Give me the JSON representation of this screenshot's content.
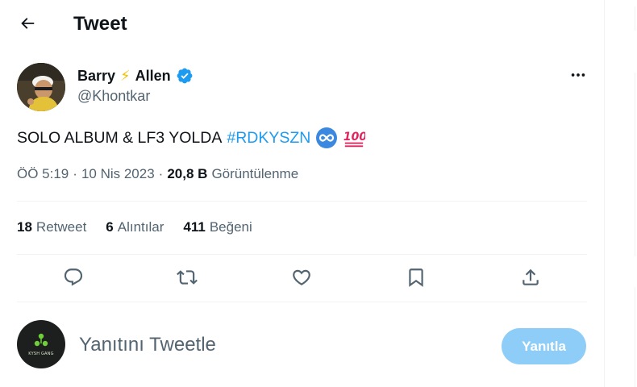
{
  "header": {
    "title": "Tweet",
    "back_icon": "arrow-left-icon"
  },
  "author": {
    "display_name_first": "Barry",
    "display_name_emoji": "⚡",
    "display_name_last": "Allen",
    "handle": "@Khontkar",
    "verified_icon": "verified-badge-icon",
    "verified_color": "#1d9bf0"
  },
  "tweet": {
    "text": "SOLO ALBUM & LF3 YOLDA",
    "hashtag": "#RDKYSZN",
    "emojis": [
      "infinity-emoji",
      "hundred-points-emoji"
    ]
  },
  "meta": {
    "time": "ÖÖ 5:19",
    "separator": "·",
    "date": "10 Nis 2023",
    "views_count": "20,8 B",
    "views_label": "Görüntülenme"
  },
  "stats": [
    {
      "count": "18",
      "label": "Retweet"
    },
    {
      "count": "6",
      "label": "Alıntılar"
    },
    {
      "count": "411",
      "label": "Beğeni"
    }
  ],
  "actions": [
    "reply-icon",
    "retweet-icon",
    "like-icon",
    "bookmark-icon",
    "share-icon"
  ],
  "reply": {
    "avatar_text": "KYSH GANG",
    "placeholder": "Yanıtını Tweetle",
    "button_label": "Yanıtla",
    "button_color": "#8ecdf8"
  },
  "colors": {
    "accent": "#1d9bf0",
    "secondary_text": "#536471",
    "primary_text": "#0f1419",
    "divider": "#eff3f4"
  }
}
